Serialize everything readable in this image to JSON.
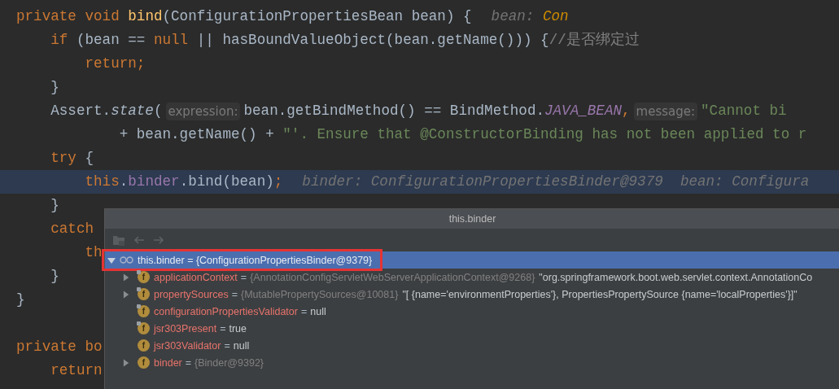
{
  "editor": {
    "lines": [
      {
        "kind": "code",
        "tokens": [
          {
            "text": "private void ",
            "kind": "keyword"
          },
          {
            "text": "bind",
            "kind": "method"
          },
          {
            "text": "(ConfigurationPropertiesBean bean) {",
            "kind": "plain"
          },
          {
            "text": "bean: ",
            "kind": "debug"
          },
          {
            "text": "Con",
            "kind": "debug-value"
          }
        ]
      },
      {
        "kind": "code",
        "tokens": [
          {
            "text": "    if ",
            "kind": "keyword"
          },
          {
            "text": "(bean == ",
            "kind": "plain"
          },
          {
            "text": "null ",
            "kind": "keyword"
          },
          {
            "text": "|| hasBoundValueObject(bean.getName())) {",
            "kind": "plain"
          },
          {
            "text": "//是否绑定过",
            "kind": "comment"
          }
        ]
      },
      {
        "kind": "code",
        "tokens": [
          {
            "text": "        return;",
            "kind": "keyword"
          }
        ]
      },
      {
        "kind": "code",
        "tokens": [
          {
            "text": "    }",
            "kind": "plain"
          }
        ]
      },
      {
        "kind": "code",
        "tokens": [
          {
            "text": "    Assert.",
            "kind": "plain"
          },
          {
            "text": "state",
            "kind": "static"
          },
          {
            "text": "(",
            "kind": "plain"
          },
          {
            "text": "expression:",
            "kind": "param-hint"
          },
          {
            "text": "bean.getBindMethod() == BindMethod.",
            "kind": "plain"
          },
          {
            "text": "JAVA_BEAN",
            "kind": "constant"
          },
          {
            "text": ",",
            "kind": "keyword"
          },
          {
            "text": "message:",
            "kind": "param-hint"
          },
          {
            "text": "\"Cannot bi",
            "kind": "string"
          }
        ]
      },
      {
        "kind": "code",
        "tokens": [
          {
            "text": "            + bean.getName() + ",
            "kind": "plain"
          },
          {
            "text": "\"'. Ensure that @ConstructorBinding has not been applied to r",
            "kind": "string"
          }
        ]
      },
      {
        "kind": "code",
        "tokens": [
          {
            "text": "    try ",
            "kind": "keyword"
          },
          {
            "text": "{",
            "kind": "plain"
          }
        ]
      },
      {
        "kind": "current",
        "tokens": [
          {
            "text": "        this",
            "kind": "keyword"
          },
          {
            "text": ".",
            "kind": "plain"
          },
          {
            "text": "binder",
            "kind": "field"
          },
          {
            "text": ".bind(bean)",
            "kind": "plain"
          },
          {
            "text": ";",
            "kind": "keyword"
          },
          {
            "text": "binder: ConfigurationPropertiesBinder@9379  bean: Configura",
            "kind": "debug"
          }
        ]
      },
      {
        "kind": "code",
        "tokens": [
          {
            "text": "    }",
            "kind": "plain"
          }
        ]
      },
      {
        "kind": "code",
        "tokens": [
          {
            "text": "    catch",
            "kind": "keyword"
          }
        ]
      },
      {
        "kind": "code",
        "tokens": [
          {
            "text": "        th",
            "kind": "keyword"
          }
        ]
      },
      {
        "kind": "code",
        "tokens": [
          {
            "text": "    }",
            "kind": "plain"
          }
        ]
      },
      {
        "kind": "code",
        "tokens": [
          {
            "text": "}",
            "kind": "plain"
          }
        ]
      },
      {
        "kind": "blank"
      },
      {
        "kind": "code",
        "tokens": [
          {
            "text": "private bo",
            "kind": "keyword"
          }
        ]
      },
      {
        "kind": "code",
        "tokens": [
          {
            "text": "    return",
            "kind": "keyword"
          }
        ]
      }
    ]
  },
  "popup": {
    "title": "this.binder",
    "tree": {
      "label": "this.binder = {ConfigurationPropertiesBinder@9379}",
      "selected": true,
      "outlined": true,
      "expanded": true,
      "children": [
        {
          "badge": "f",
          "final": true,
          "expandable": true,
          "expanded": false,
          "name": "applicationContext",
          "operator": "=",
          "type": "{AnnotationConfigServletWebServerApplicationContext@9268}",
          "value": "\"org.springframework.boot.web.servlet.context.AnnotationCo"
        },
        {
          "badge": "f",
          "final": true,
          "expandable": true,
          "expanded": false,
          "name": "propertySources",
          "operator": "=",
          "type": "{MutablePropertySources@10081}",
          "value": "\"[ {name='environmentProperties'}, PropertiesPropertySource {name='localProperties'}]\""
        },
        {
          "badge": "f",
          "final": true,
          "expandable": false,
          "name": "configurationPropertiesValidator",
          "operator": "=",
          "value": "null"
        },
        {
          "badge": "f",
          "final": true,
          "expandable": false,
          "name": "jsr303Present",
          "operator": "=",
          "value": "true"
        },
        {
          "badge": "f",
          "final": false,
          "expandable": false,
          "name": "jsr303Validator",
          "operator": "=",
          "value": "null"
        },
        {
          "badge": "f",
          "final": false,
          "expandable": true,
          "expanded": false,
          "name": "binder",
          "operator": "=",
          "type": "{Binder@9392}"
        }
      ]
    }
  }
}
